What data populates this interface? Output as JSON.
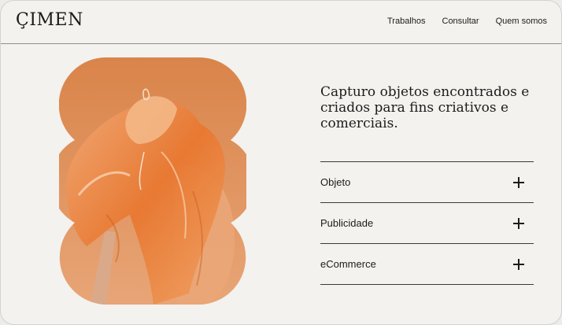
{
  "brand": {
    "logo": "ÇIMEN"
  },
  "nav": {
    "items": [
      "Trabalhos",
      "Consultar",
      "Quem somos"
    ]
  },
  "hero": {
    "headline": "Capturo objetos encontrados e criados para fins criativos e comerciais.",
    "image_alt": "orange plastic draped over a figure"
  },
  "accordion": {
    "items": [
      {
        "label": "Objeto",
        "icon": "plus-icon"
      },
      {
        "label": "Publicidade",
        "icon": "plus-icon"
      },
      {
        "label": "eCommerce",
        "icon": "plus-icon"
      }
    ]
  },
  "colors": {
    "background": "#f3f2ef",
    "accent": "#e8823f",
    "text": "#1c1c1c"
  }
}
